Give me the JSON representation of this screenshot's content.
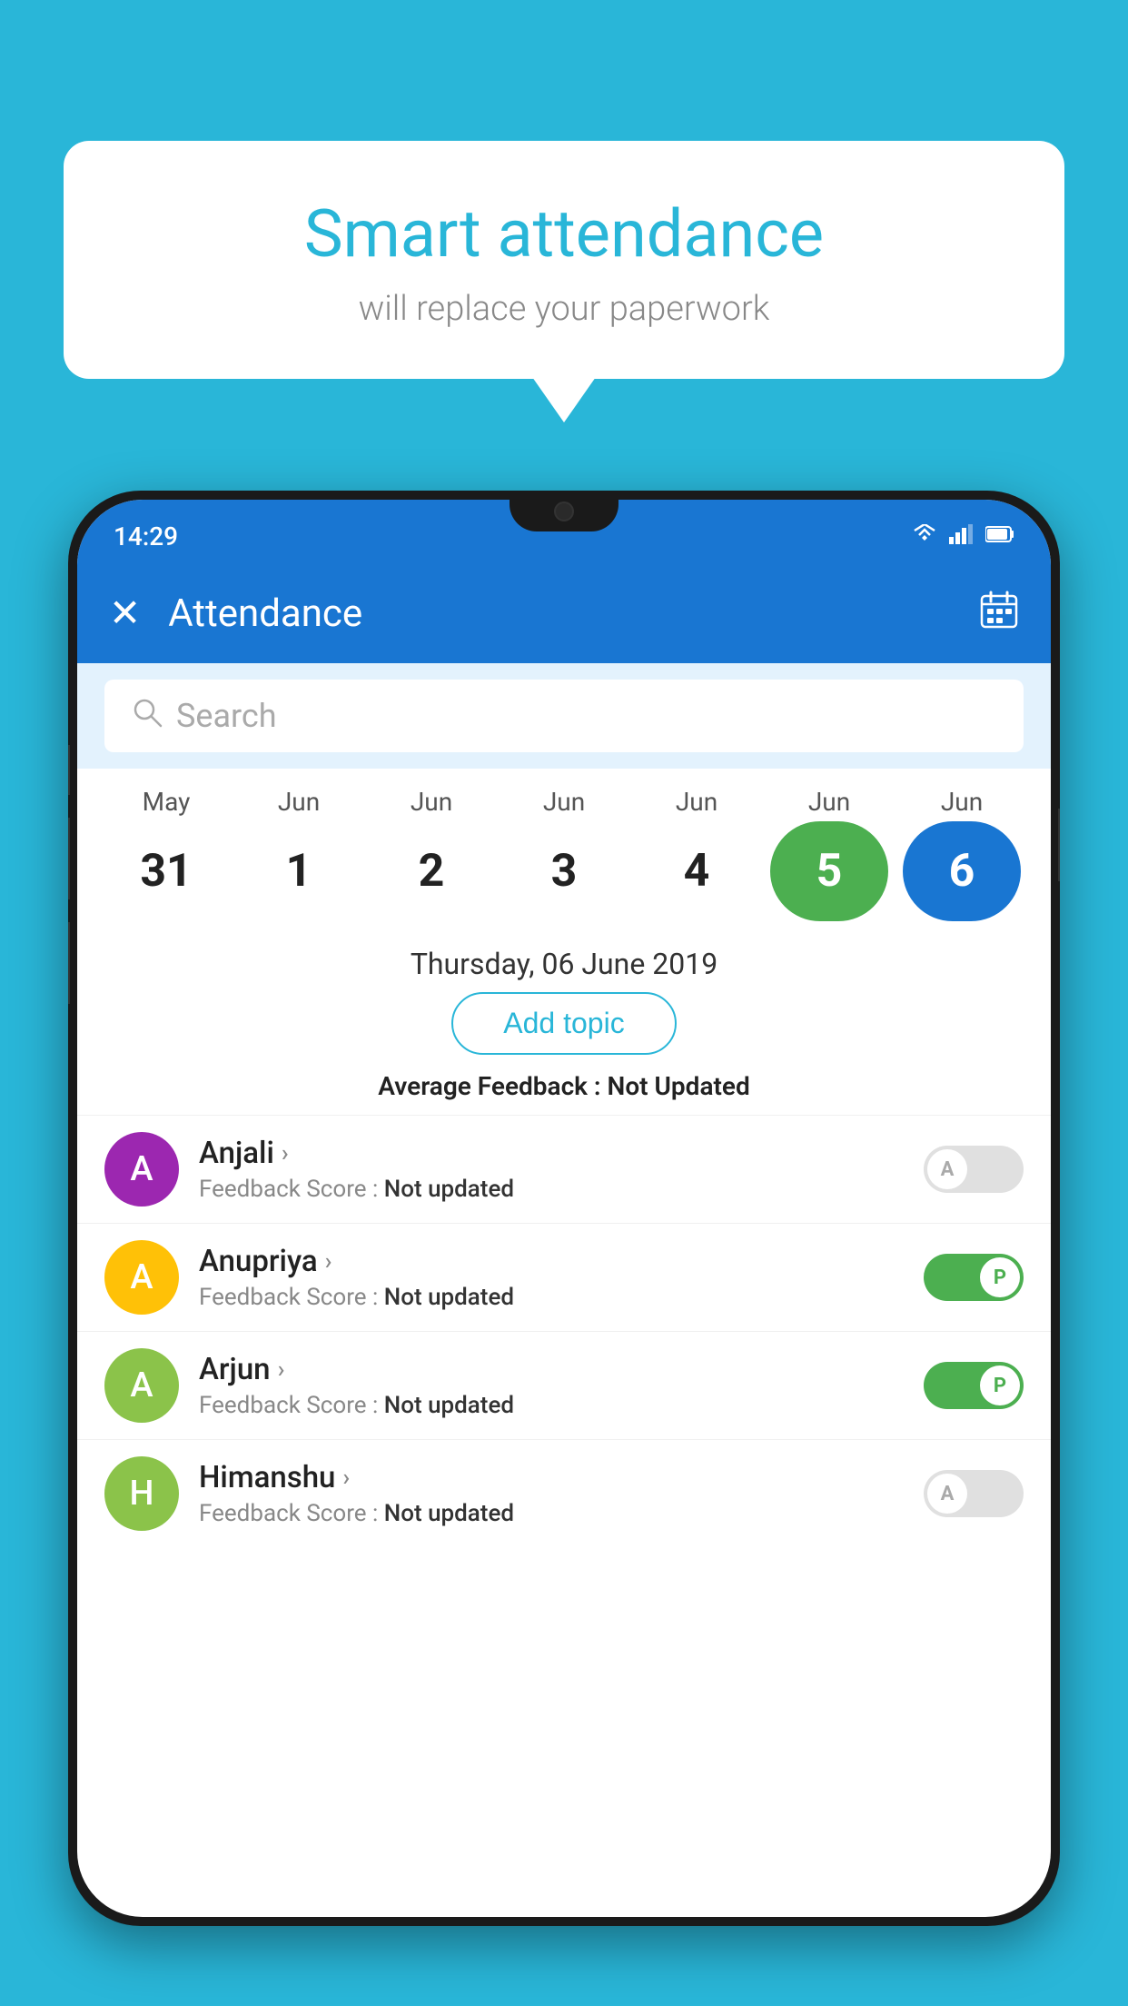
{
  "background_color": "#29B6D8",
  "bubble": {
    "title": "Smart attendance",
    "subtitle": "will replace your paperwork"
  },
  "status_bar": {
    "time": "14:29",
    "wifi": "▾",
    "signal": "◂",
    "battery": "▮"
  },
  "app_bar": {
    "close_label": "✕",
    "title": "Attendance",
    "calendar_icon": "📅"
  },
  "search": {
    "placeholder": "Search"
  },
  "calendar": {
    "months": [
      "May",
      "Jun",
      "Jun",
      "Jun",
      "Jun",
      "Jun",
      "Jun"
    ],
    "dates": [
      {
        "date": "31",
        "state": "normal"
      },
      {
        "date": "1",
        "state": "normal"
      },
      {
        "date": "2",
        "state": "normal"
      },
      {
        "date": "3",
        "state": "normal"
      },
      {
        "date": "4",
        "state": "normal"
      },
      {
        "date": "5",
        "state": "today"
      },
      {
        "date": "6",
        "state": "selected"
      }
    ]
  },
  "selected_date_label": "Thursday, 06 June 2019",
  "add_topic_label": "Add topic",
  "avg_feedback_label": "Average Feedback : ",
  "avg_feedback_value": "Not Updated",
  "students": [
    {
      "name": "Anjali",
      "avatar_letter": "A",
      "avatar_color": "#9C27B0",
      "feedback_label": "Feedback Score : ",
      "feedback_value": "Not updated",
      "toggle_state": "off",
      "toggle_label": "A"
    },
    {
      "name": "Anupriya",
      "avatar_letter": "A",
      "avatar_color": "#FFC107",
      "feedback_label": "Feedback Score : ",
      "feedback_value": "Not updated",
      "toggle_state": "on",
      "toggle_label": "P"
    },
    {
      "name": "Arjun",
      "avatar_letter": "A",
      "avatar_color": "#8BC34A",
      "feedback_label": "Feedback Score : ",
      "feedback_value": "Not updated",
      "toggle_state": "on",
      "toggle_label": "P"
    },
    {
      "name": "Himanshu",
      "avatar_letter": "H",
      "avatar_color": "#8BC34A",
      "feedback_label": "Feedback Score : ",
      "feedback_value": "Not updated",
      "toggle_state": "off",
      "toggle_label": "A"
    }
  ]
}
